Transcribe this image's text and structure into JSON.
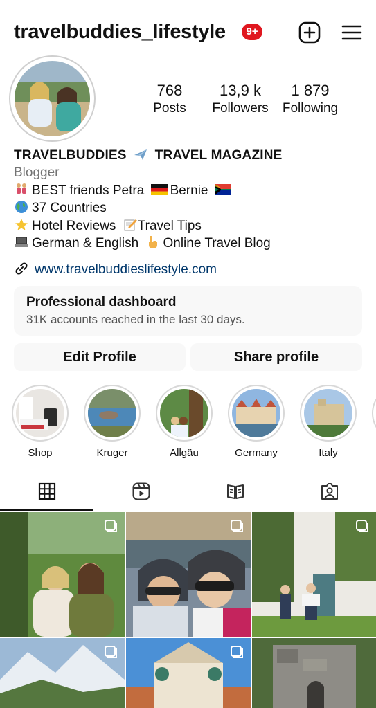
{
  "header": {
    "username": "travelbuddies_lifestyle",
    "notification_badge": "9+",
    "create_icon": "plus-square-icon",
    "menu_icon": "hamburger-menu-icon"
  },
  "stats": {
    "posts_count": "768",
    "posts_label": "Posts",
    "followers_count": "13,9 k",
    "followers_label": "Followers",
    "following_count": "1 879",
    "following_label": "Following"
  },
  "bio": {
    "name_prefix": "TRAVELBUDDIES",
    "name_suffix": "TRAVEL MAGAZINE",
    "category": "Blogger",
    "line1_text": "BEST friends Petra",
    "line1_text2": "Bernie",
    "line2_text": "37 Countries",
    "line3_text": "Hotel Reviews",
    "line3_text2": "Travel Tips",
    "line4_text": "German & English",
    "line4_text2": "Online Travel Blog",
    "website": "www.travelbuddieslifestyle.com"
  },
  "dashboard": {
    "title": "Professional dashboard",
    "subtitle": "31K accounts reached in the last 30 days."
  },
  "buttons": {
    "edit_profile": "Edit Profile",
    "share_profile": "Share profile"
  },
  "highlights": [
    {
      "label": "Shop"
    },
    {
      "label": "Kruger"
    },
    {
      "label": "Allgäu"
    },
    {
      "label": "Germany"
    },
    {
      "label": "Italy"
    }
  ],
  "tabs": [
    {
      "icon": "grid-icon",
      "active": true
    },
    {
      "icon": "reels-icon",
      "active": false
    },
    {
      "icon": "guide-book-icon",
      "active": false
    },
    {
      "icon": "tagged-person-icon",
      "active": false
    }
  ],
  "colors": {
    "badge_red": "#e0171f",
    "link_blue": "#00376b",
    "button_bg": "#f8f8f8"
  }
}
